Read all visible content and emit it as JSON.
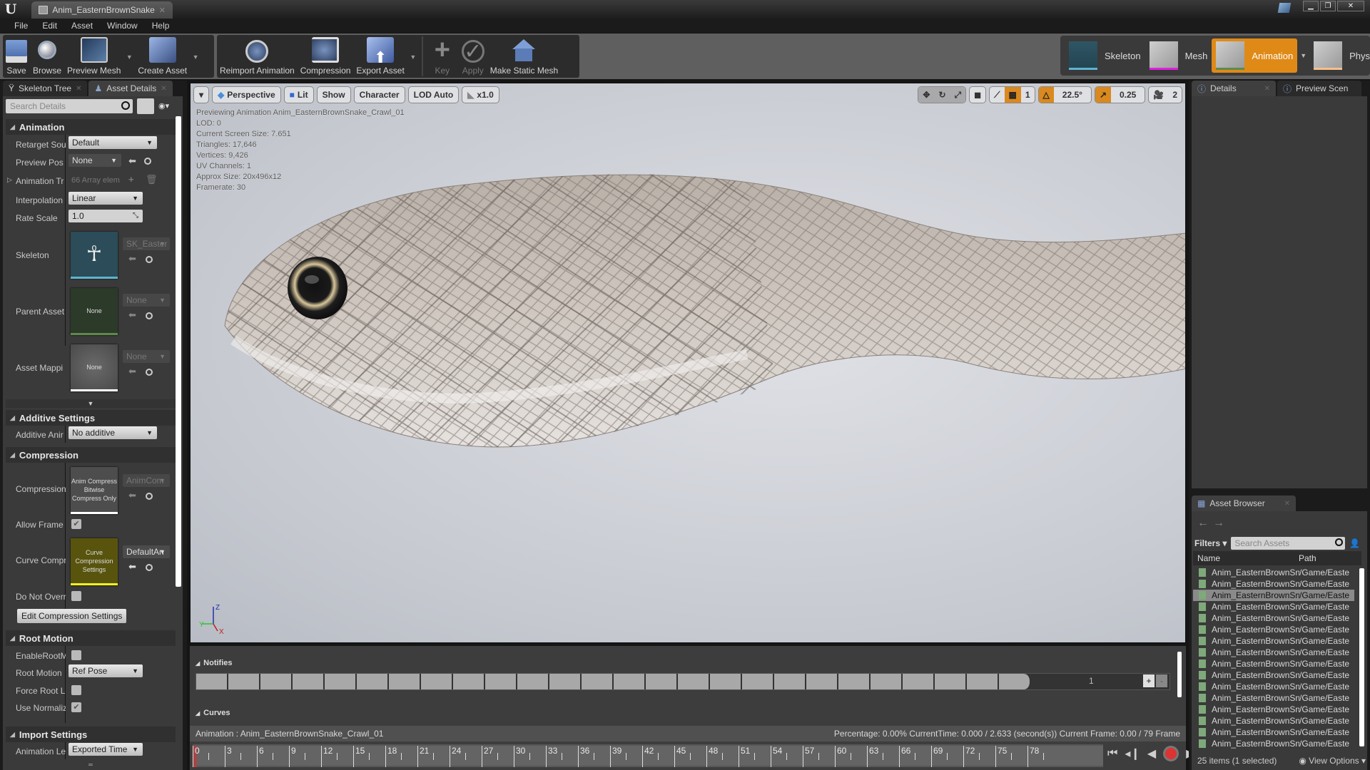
{
  "window": {
    "tab_title": "Anim_EasternBrownSnake",
    "controls": [
      "minimize",
      "restore",
      "close"
    ]
  },
  "menu": [
    "File",
    "Edit",
    "Asset",
    "Window",
    "Help"
  ],
  "toolbar": {
    "buttons": [
      {
        "label": "Save",
        "icon": "save-icon",
        "enabled": true
      },
      {
        "label": "Browse",
        "icon": "browse-icon",
        "enabled": true
      },
      {
        "label": "Preview Mesh",
        "icon": "preview-mesh-icon",
        "enabled": true
      },
      {
        "label": "Create Asset",
        "icon": "create-asset-icon",
        "enabled": true
      },
      {
        "label": "Reimport Animation",
        "icon": "reimport-icon",
        "enabled": true
      },
      {
        "label": "Compression",
        "icon": "compression-icon",
        "enabled": true
      },
      {
        "label": "Export Asset",
        "icon": "export-icon",
        "enabled": true
      },
      {
        "label": "Key",
        "icon": "key-plus-icon",
        "enabled": false
      },
      {
        "label": "Apply",
        "icon": "apply-check-icon",
        "enabled": false
      },
      {
        "label": "Make Static Mesh",
        "icon": "static-mesh-icon",
        "enabled": true
      }
    ]
  },
  "modes": [
    {
      "label": "Skeleton",
      "accent": "#5fb4d0",
      "active": false
    },
    {
      "label": "Mesh",
      "accent": "#e020e0",
      "active": false
    },
    {
      "label": "Animation",
      "accent": "#5d8a4c",
      "active": true
    },
    {
      "label": "Physics",
      "accent": "#f7c08a",
      "active": false
    }
  ],
  "left_panel": {
    "tabs": [
      "Skeleton Tree",
      "Asset Details"
    ],
    "active_tab": "Asset Details",
    "search_placeholder": "Search Details",
    "sections": {
      "animation": {
        "title": "Animation",
        "retarget_source": {
          "label": "Retarget Sou",
          "value": "Default"
        },
        "preview_pose": {
          "label": "Preview Pos",
          "value": "None"
        },
        "animation_track": {
          "label": "Animation Tr",
          "value": "66 Array elem"
        },
        "interpolation": {
          "label": "Interpolation",
          "value": "Linear"
        },
        "rate_scale": {
          "label": "Rate Scale",
          "value": "1.0"
        },
        "skeleton": {
          "label": "Skeleton",
          "value": "SK_Easter"
        },
        "parent_asset": {
          "label": "Parent Asset",
          "value": "None",
          "thumb": "None"
        },
        "asset_mapping": {
          "label": "Asset Mappi",
          "value": "None",
          "thumb": "None"
        }
      },
      "additive": {
        "title": "Additive Settings",
        "additive_anim": {
          "label": "Additive Anir",
          "value": "No additive"
        }
      },
      "compression": {
        "title": "Compression",
        "compression_scheme": {
          "label": "Compression",
          "thumb": "Anim Compress Bitwise Compress Only",
          "value": "AnimCom"
        },
        "allow_frame": {
          "label": "Allow Frame",
          "checked": true
        },
        "curve_compression": {
          "label": "Curve Compr",
          "thumb": "Curve Compression Settings",
          "value": "DefaultAn"
        },
        "do_not_override": {
          "label": "Do Not Overr",
          "checked": false
        },
        "edit_button": "Edit Compression Settings"
      },
      "root_motion": {
        "title": "Root Motion",
        "enable_root_motion": {
          "label": "EnableRootM",
          "checked": false
        },
        "root_motion_lock": {
          "label": "Root Motion",
          "value": "Ref Pose"
        },
        "force_root_lock": {
          "label": "Force Root Lc",
          "checked": false
        },
        "use_normalized": {
          "label": "Use Normaliz",
          "checked": true
        }
      },
      "import": {
        "title": "Import Settings",
        "animation_length": {
          "label": "Animation Le",
          "value": "Exported Time"
        }
      }
    }
  },
  "viewport": {
    "buttons": [
      "Perspective",
      "Lit",
      "Show",
      "Character",
      "LOD Auto",
      "x1.0"
    ],
    "grid_snap": "1",
    "rotation_snap": "22.5°",
    "scale_snap": "0.25",
    "camera_speed": "2",
    "info": [
      "Previewing Animation Anim_EasternBrownSnake_Crawl_01",
      "LOD: 0",
      "Current Screen Size: 7.651",
      "Triangles: 17,646",
      "Vertices: 9,426",
      "UV Channels: 1",
      "Approx Size: 20x496x12",
      "Framerate: 30"
    ],
    "axes": {
      "z": "Z",
      "y": "Y",
      "x": "X"
    }
  },
  "timeline": {
    "notifies_label": "Notifies",
    "curves_label": "Curves",
    "track_count": "1",
    "animation_label": "Animation :  Anim_EasternBrownSnake_Crawl_01",
    "status": "Percentage:  0.00% CurrentTime:  0.000 / 2.633 (second(s)) Current Frame:  0.00 / 79 Frame",
    "ticks": [
      "0",
      "3",
      "6",
      "9",
      "12",
      "15",
      "18",
      "21",
      "24",
      "27",
      "30",
      "33",
      "36",
      "39",
      "42",
      "45",
      "48",
      "51",
      "54",
      "57",
      "60",
      "63",
      "66",
      "69",
      "72",
      "75",
      "78"
    ],
    "transport": [
      "to-start",
      "step-back",
      "play-reverse",
      "record",
      "play",
      "step-forward",
      "to-end",
      "loop"
    ]
  },
  "right_panel": {
    "tabs": [
      "Details",
      "Preview Scen"
    ],
    "asset_browser": {
      "tab": "Asset Browser",
      "filters_label": "Filters",
      "search_placeholder": "Search Assets",
      "columns": [
        "Name",
        "Path"
      ],
      "items": [
        {
          "name": "Anim_EasternBrownSn",
          "path": "/Game/Easte",
          "selected": false
        },
        {
          "name": "Anim_EasternBrownSn",
          "path": "/Game/Easte",
          "selected": false
        },
        {
          "name": "Anim_EasternBrownSn",
          "path": "/Game/Easte",
          "selected": true
        },
        {
          "name": "Anim_EasternBrownSn",
          "path": "/Game/Easte",
          "selected": false
        },
        {
          "name": "Anim_EasternBrownSn",
          "path": "/Game/Easte",
          "selected": false
        },
        {
          "name": "Anim_EasternBrownSn",
          "path": "/Game/Easte",
          "selected": false
        },
        {
          "name": "Anim_EasternBrownSn",
          "path": "/Game/Easte",
          "selected": false
        },
        {
          "name": "Anim_EasternBrownSn",
          "path": "/Game/Easte",
          "selected": false
        },
        {
          "name": "Anim_EasternBrownSn",
          "path": "/Game/Easte",
          "selected": false
        },
        {
          "name": "Anim_EasternBrownSn",
          "path": "/Game/Easte",
          "selected": false
        },
        {
          "name": "Anim_EasternBrownSn",
          "path": "/Game/Easte",
          "selected": false
        },
        {
          "name": "Anim_EasternBrownSn",
          "path": "/Game/Easte",
          "selected": false
        },
        {
          "name": "Anim_EasternBrownSn",
          "path": "/Game/Easte",
          "selected": false
        },
        {
          "name": "Anim_EasternBrownSn",
          "path": "/Game/Easte",
          "selected": false
        },
        {
          "name": "Anim_EasternBrownSn",
          "path": "/Game/Easte",
          "selected": false
        },
        {
          "name": "Anim_EasternBrownSn",
          "path": "/Game/Easte",
          "selected": false
        }
      ],
      "footer": "25 items (1 selected)",
      "view_options": "View Options"
    }
  }
}
